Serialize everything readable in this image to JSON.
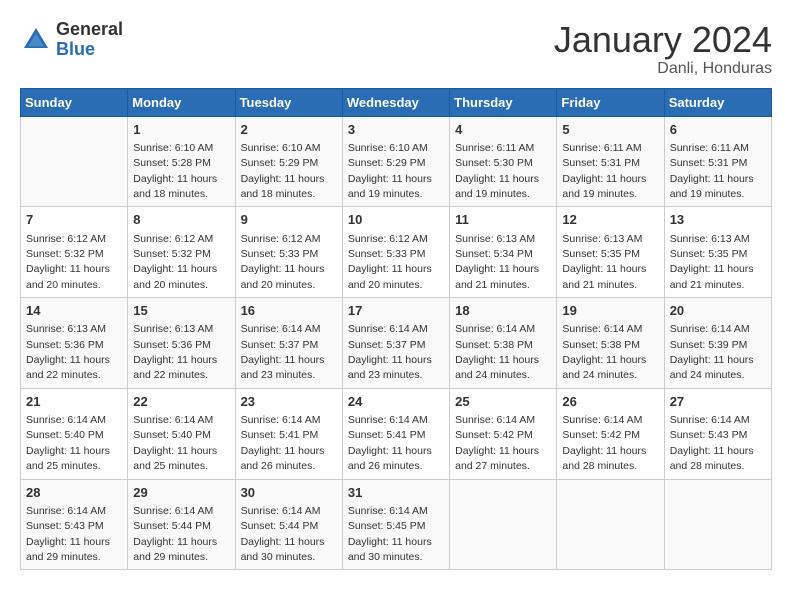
{
  "header": {
    "logo_general": "General",
    "logo_blue": "Blue",
    "month_year": "January 2024",
    "location": "Danli, Honduras"
  },
  "weekdays": [
    "Sunday",
    "Monday",
    "Tuesday",
    "Wednesday",
    "Thursday",
    "Friday",
    "Saturday"
  ],
  "weeks": [
    [
      {
        "day": "",
        "sunrise": "",
        "sunset": "",
        "daylight": ""
      },
      {
        "day": "1",
        "sunrise": "Sunrise: 6:10 AM",
        "sunset": "Sunset: 5:28 PM",
        "daylight": "Daylight: 11 hours and 18 minutes."
      },
      {
        "day": "2",
        "sunrise": "Sunrise: 6:10 AM",
        "sunset": "Sunset: 5:29 PM",
        "daylight": "Daylight: 11 hours and 18 minutes."
      },
      {
        "day": "3",
        "sunrise": "Sunrise: 6:10 AM",
        "sunset": "Sunset: 5:29 PM",
        "daylight": "Daylight: 11 hours and 19 minutes."
      },
      {
        "day": "4",
        "sunrise": "Sunrise: 6:11 AM",
        "sunset": "Sunset: 5:30 PM",
        "daylight": "Daylight: 11 hours and 19 minutes."
      },
      {
        "day": "5",
        "sunrise": "Sunrise: 6:11 AM",
        "sunset": "Sunset: 5:31 PM",
        "daylight": "Daylight: 11 hours and 19 minutes."
      },
      {
        "day": "6",
        "sunrise": "Sunrise: 6:11 AM",
        "sunset": "Sunset: 5:31 PM",
        "daylight": "Daylight: 11 hours and 19 minutes."
      }
    ],
    [
      {
        "day": "7",
        "sunrise": "Sunrise: 6:12 AM",
        "sunset": "Sunset: 5:32 PM",
        "daylight": "Daylight: 11 hours and 20 minutes."
      },
      {
        "day": "8",
        "sunrise": "Sunrise: 6:12 AM",
        "sunset": "Sunset: 5:32 PM",
        "daylight": "Daylight: 11 hours and 20 minutes."
      },
      {
        "day": "9",
        "sunrise": "Sunrise: 6:12 AM",
        "sunset": "Sunset: 5:33 PM",
        "daylight": "Daylight: 11 hours and 20 minutes."
      },
      {
        "day": "10",
        "sunrise": "Sunrise: 6:12 AM",
        "sunset": "Sunset: 5:33 PM",
        "daylight": "Daylight: 11 hours and 20 minutes."
      },
      {
        "day": "11",
        "sunrise": "Sunrise: 6:13 AM",
        "sunset": "Sunset: 5:34 PM",
        "daylight": "Daylight: 11 hours and 21 minutes."
      },
      {
        "day": "12",
        "sunrise": "Sunrise: 6:13 AM",
        "sunset": "Sunset: 5:35 PM",
        "daylight": "Daylight: 11 hours and 21 minutes."
      },
      {
        "day": "13",
        "sunrise": "Sunrise: 6:13 AM",
        "sunset": "Sunset: 5:35 PM",
        "daylight": "Daylight: 11 hours and 21 minutes."
      }
    ],
    [
      {
        "day": "14",
        "sunrise": "Sunrise: 6:13 AM",
        "sunset": "Sunset: 5:36 PM",
        "daylight": "Daylight: 11 hours and 22 minutes."
      },
      {
        "day": "15",
        "sunrise": "Sunrise: 6:13 AM",
        "sunset": "Sunset: 5:36 PM",
        "daylight": "Daylight: 11 hours and 22 minutes."
      },
      {
        "day": "16",
        "sunrise": "Sunrise: 6:14 AM",
        "sunset": "Sunset: 5:37 PM",
        "daylight": "Daylight: 11 hours and 23 minutes."
      },
      {
        "day": "17",
        "sunrise": "Sunrise: 6:14 AM",
        "sunset": "Sunset: 5:37 PM",
        "daylight": "Daylight: 11 hours and 23 minutes."
      },
      {
        "day": "18",
        "sunrise": "Sunrise: 6:14 AM",
        "sunset": "Sunset: 5:38 PM",
        "daylight": "Daylight: 11 hours and 24 minutes."
      },
      {
        "day": "19",
        "sunrise": "Sunrise: 6:14 AM",
        "sunset": "Sunset: 5:38 PM",
        "daylight": "Daylight: 11 hours and 24 minutes."
      },
      {
        "day": "20",
        "sunrise": "Sunrise: 6:14 AM",
        "sunset": "Sunset: 5:39 PM",
        "daylight": "Daylight: 11 hours and 24 minutes."
      }
    ],
    [
      {
        "day": "21",
        "sunrise": "Sunrise: 6:14 AM",
        "sunset": "Sunset: 5:40 PM",
        "daylight": "Daylight: 11 hours and 25 minutes."
      },
      {
        "day": "22",
        "sunrise": "Sunrise: 6:14 AM",
        "sunset": "Sunset: 5:40 PM",
        "daylight": "Daylight: 11 hours and 25 minutes."
      },
      {
        "day": "23",
        "sunrise": "Sunrise: 6:14 AM",
        "sunset": "Sunset: 5:41 PM",
        "daylight": "Daylight: 11 hours and 26 minutes."
      },
      {
        "day": "24",
        "sunrise": "Sunrise: 6:14 AM",
        "sunset": "Sunset: 5:41 PM",
        "daylight": "Daylight: 11 hours and 26 minutes."
      },
      {
        "day": "25",
        "sunrise": "Sunrise: 6:14 AM",
        "sunset": "Sunset: 5:42 PM",
        "daylight": "Daylight: 11 hours and 27 minutes."
      },
      {
        "day": "26",
        "sunrise": "Sunrise: 6:14 AM",
        "sunset": "Sunset: 5:42 PM",
        "daylight": "Daylight: 11 hours and 28 minutes."
      },
      {
        "day": "27",
        "sunrise": "Sunrise: 6:14 AM",
        "sunset": "Sunset: 5:43 PM",
        "daylight": "Daylight: 11 hours and 28 minutes."
      }
    ],
    [
      {
        "day": "28",
        "sunrise": "Sunrise: 6:14 AM",
        "sunset": "Sunset: 5:43 PM",
        "daylight": "Daylight: 11 hours and 29 minutes."
      },
      {
        "day": "29",
        "sunrise": "Sunrise: 6:14 AM",
        "sunset": "Sunset: 5:44 PM",
        "daylight": "Daylight: 11 hours and 29 minutes."
      },
      {
        "day": "30",
        "sunrise": "Sunrise: 6:14 AM",
        "sunset": "Sunset: 5:44 PM",
        "daylight": "Daylight: 11 hours and 30 minutes."
      },
      {
        "day": "31",
        "sunrise": "Sunrise: 6:14 AM",
        "sunset": "Sunset: 5:45 PM",
        "daylight": "Daylight: 11 hours and 30 minutes."
      },
      {
        "day": "",
        "sunrise": "",
        "sunset": "",
        "daylight": ""
      },
      {
        "day": "",
        "sunrise": "",
        "sunset": "",
        "daylight": ""
      },
      {
        "day": "",
        "sunrise": "",
        "sunset": "",
        "daylight": ""
      }
    ]
  ]
}
